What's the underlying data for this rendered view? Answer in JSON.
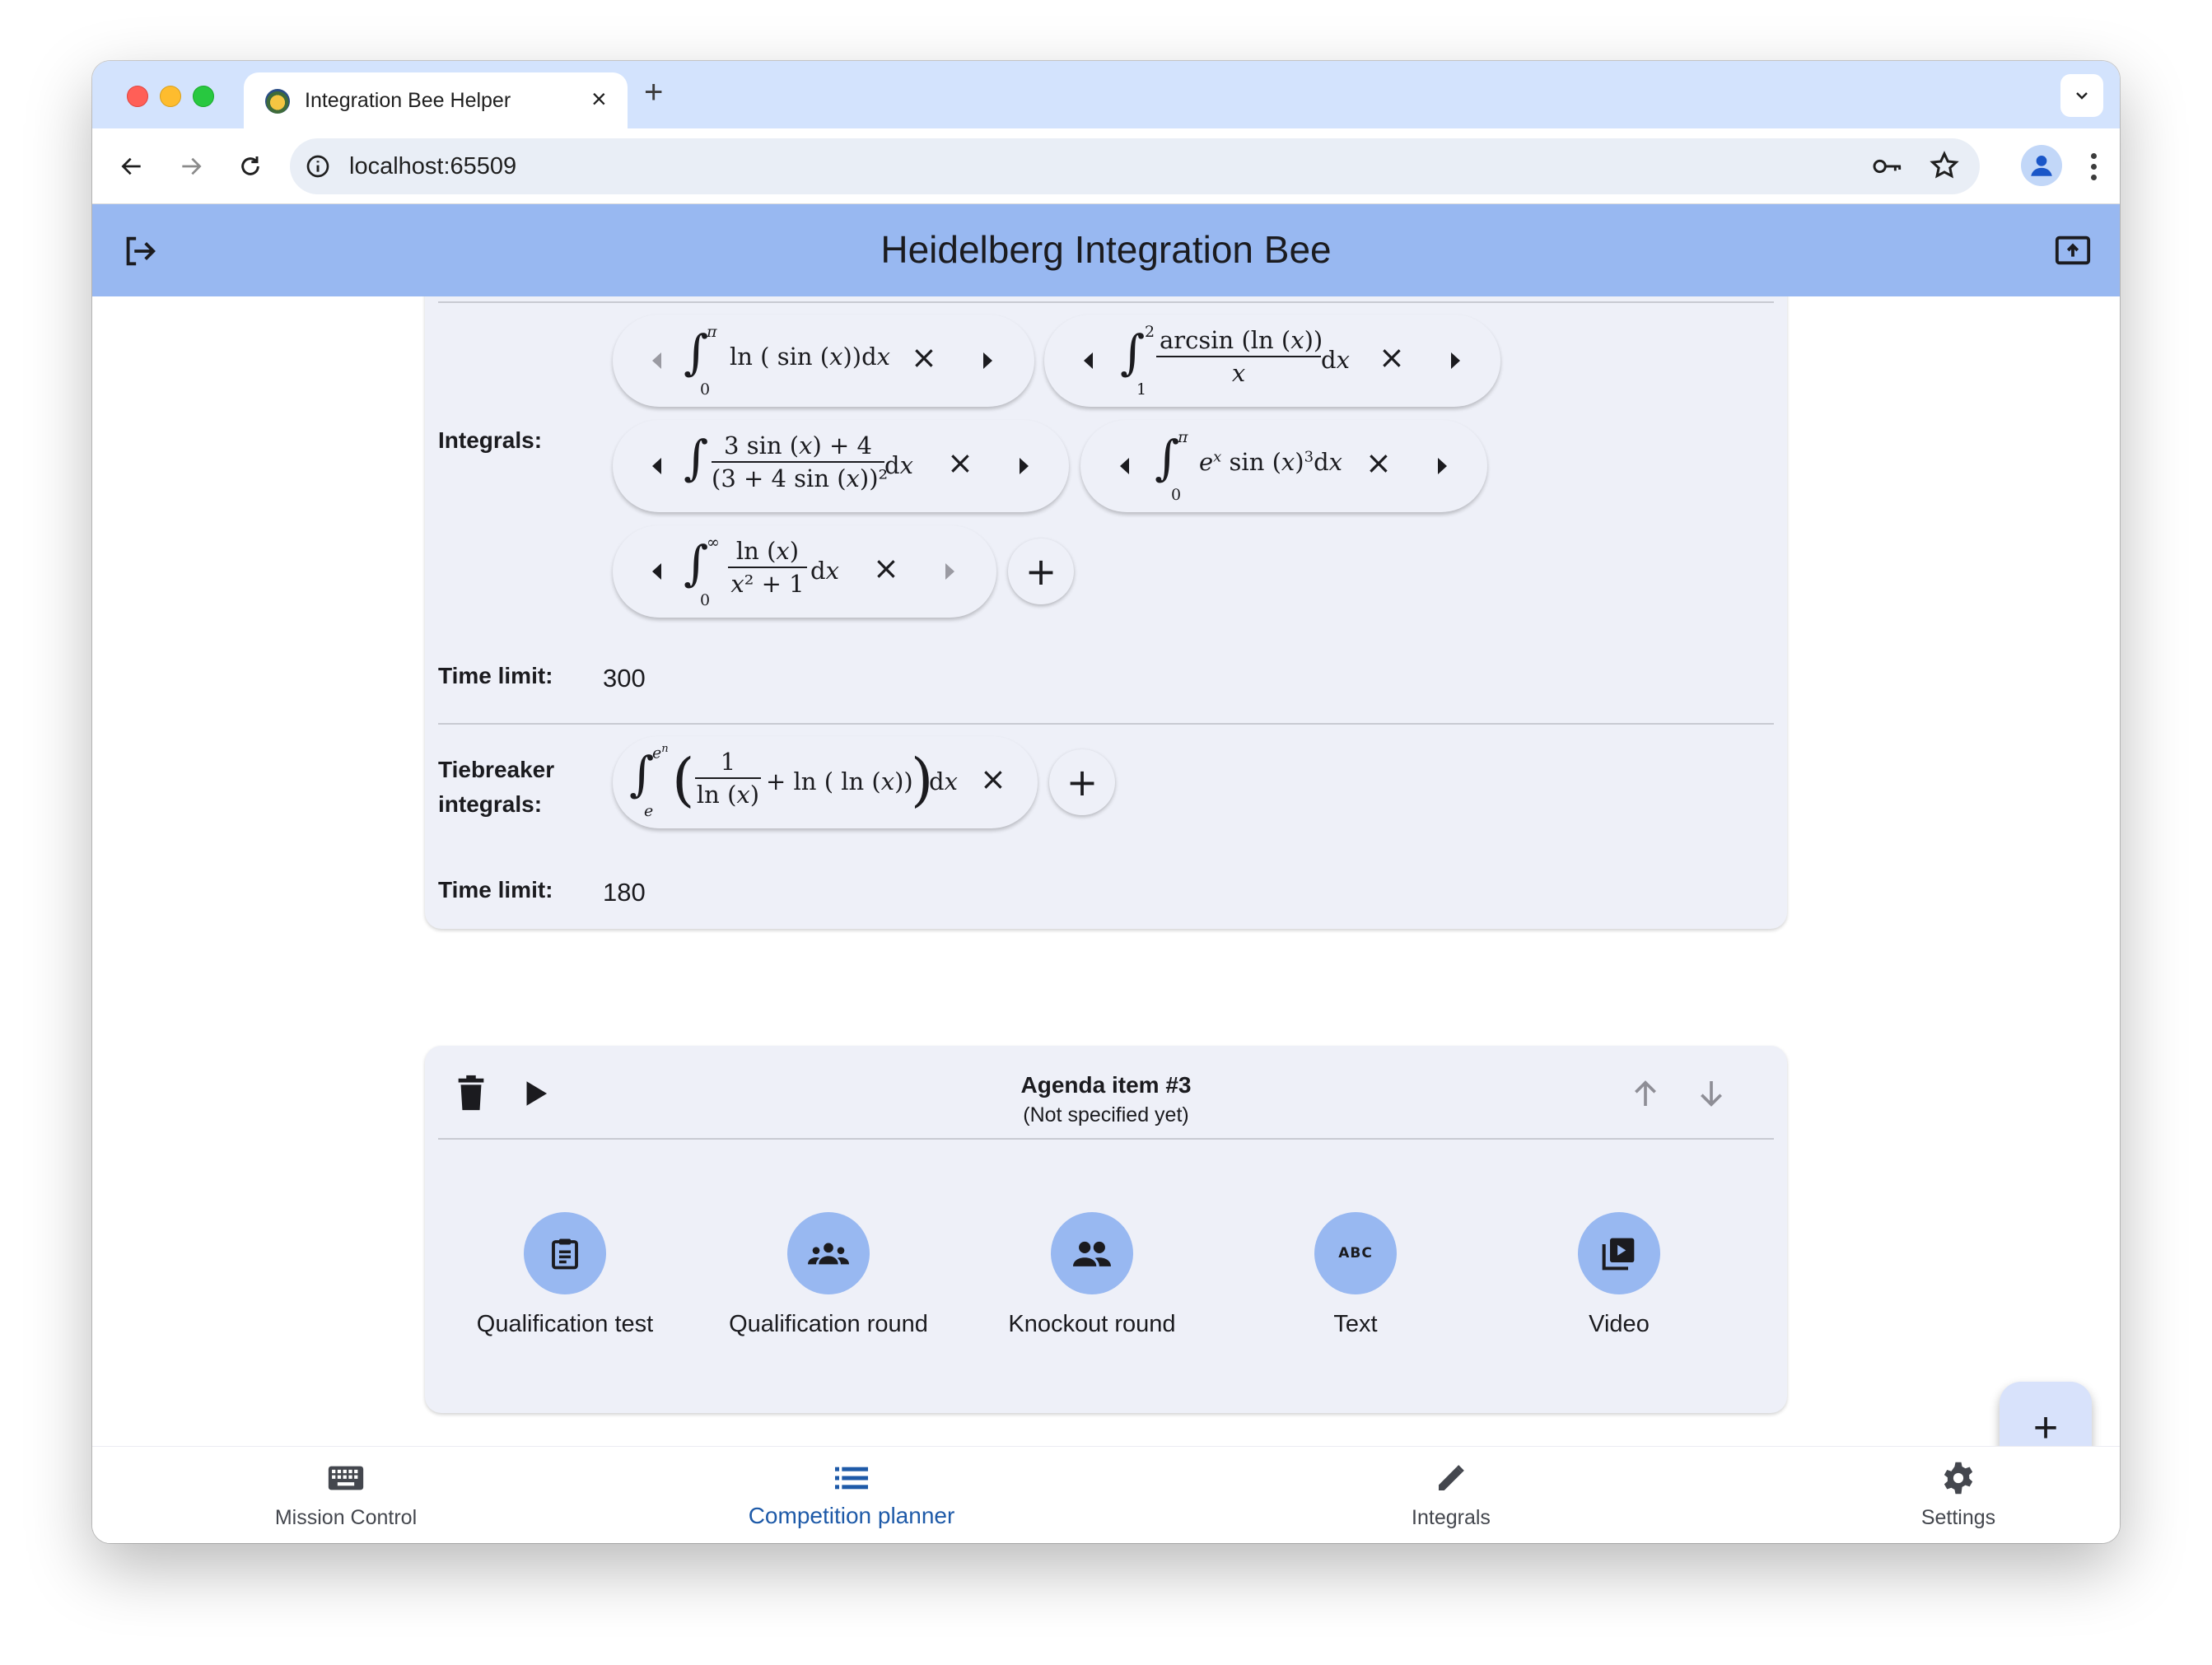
{
  "browser": {
    "tab_title": "Integration Bee Helper",
    "url": "localhost:65509"
  },
  "app": {
    "title": "Heidelberg Integration Bee",
    "colors": {
      "appbar": "#98b8f1",
      "card": "#eef0f8",
      "accent": "#1e5aa8"
    }
  },
  "round": {
    "integrals_label": "Integrals:",
    "time_limit_label": "Time limit:",
    "time_limit_value": "300",
    "tiebreaker_label_line1": "Tiebreaker",
    "tiebreaker_label_line2": "integrals:",
    "tiebreaker_time_limit_label": "Time limit:",
    "tiebreaker_time_limit_value": "180",
    "integrals": [
      {
        "tex": "∫₀^π ln(sin(x)) dx"
      },
      {
        "tex": "∫₁² arcsin(ln(x))/x dx"
      },
      {
        "tex": "∫ (3 sin(x) + 4)/(3 + 4 sin(x))² dx"
      },
      {
        "tex": "∫₀^π eˣ sin(x)³ dx"
      },
      {
        "tex": "∫₀^∞ ln(x)/(x² + 1) dx"
      }
    ],
    "tiebreaker_integrals": [
      {
        "tex": "∫ₑ^(eⁿ) (1/ln(x) + ln(ln(x))) dx"
      }
    ]
  },
  "agenda_item": {
    "title": "Agenda item #3",
    "subtitle": "(Not specified yet)",
    "types": [
      {
        "label": "Qualification test",
        "icon": "clipboard-icon"
      },
      {
        "label": "Qualification round",
        "icon": "groups-icon"
      },
      {
        "label": "Knockout round",
        "icon": "people-icon"
      },
      {
        "label": "Text",
        "icon": "abc-icon"
      },
      {
        "label": "Video",
        "icon": "video-library-icon"
      }
    ]
  },
  "bottom_nav": [
    {
      "label": "Mission Control",
      "icon": "keyboard-icon",
      "active": false
    },
    {
      "label": "Competition planner",
      "icon": "list-icon",
      "active": true
    },
    {
      "label": "Integrals",
      "icon": "pencil-icon",
      "active": false
    },
    {
      "label": "Settings",
      "icon": "gear-icon",
      "active": false
    }
  ]
}
